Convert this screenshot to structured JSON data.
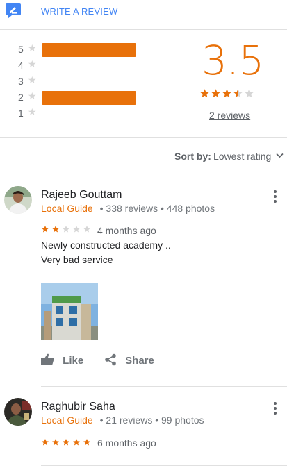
{
  "header": {
    "write_review_label": "WRITE A REVIEW"
  },
  "summary": {
    "distribution": [
      {
        "stars": "5",
        "fraction": 1.0
      },
      {
        "stars": "4",
        "fraction": 0.0
      },
      {
        "stars": "3",
        "fraction": 0.0
      },
      {
        "stars": "2",
        "fraction": 1.0
      },
      {
        "stars": "1",
        "fraction": 0.0
      }
    ],
    "average": "3.5",
    "average_stars": 3.5,
    "reviews_link": "2 reviews"
  },
  "sort": {
    "label": "Sort by:",
    "value": "Lowest rating"
  },
  "reviews": [
    {
      "name": "Rajeeb Gouttam",
      "badge": "Local Guide",
      "reviews_count": "338 reviews",
      "photos_count": "448 photos",
      "rating": 2,
      "date": "4 months ago",
      "text_line1": "Newly constructed academy ..",
      "text_line2": "Very bad service",
      "has_photo": true,
      "like_label": "Like",
      "share_label": "Share"
    },
    {
      "name": "Raghubir Saha",
      "badge": "Local Guide",
      "reviews_count": "21 reviews",
      "photos_count": "99 photos",
      "rating": 5,
      "date": "6 months ago"
    }
  ],
  "meta_separator": "•",
  "colors": {
    "accent": "#e8710a",
    "link_blue": "#4285f4",
    "star_empty": "#d6d6d6",
    "divider": "#e0e0e0"
  }
}
